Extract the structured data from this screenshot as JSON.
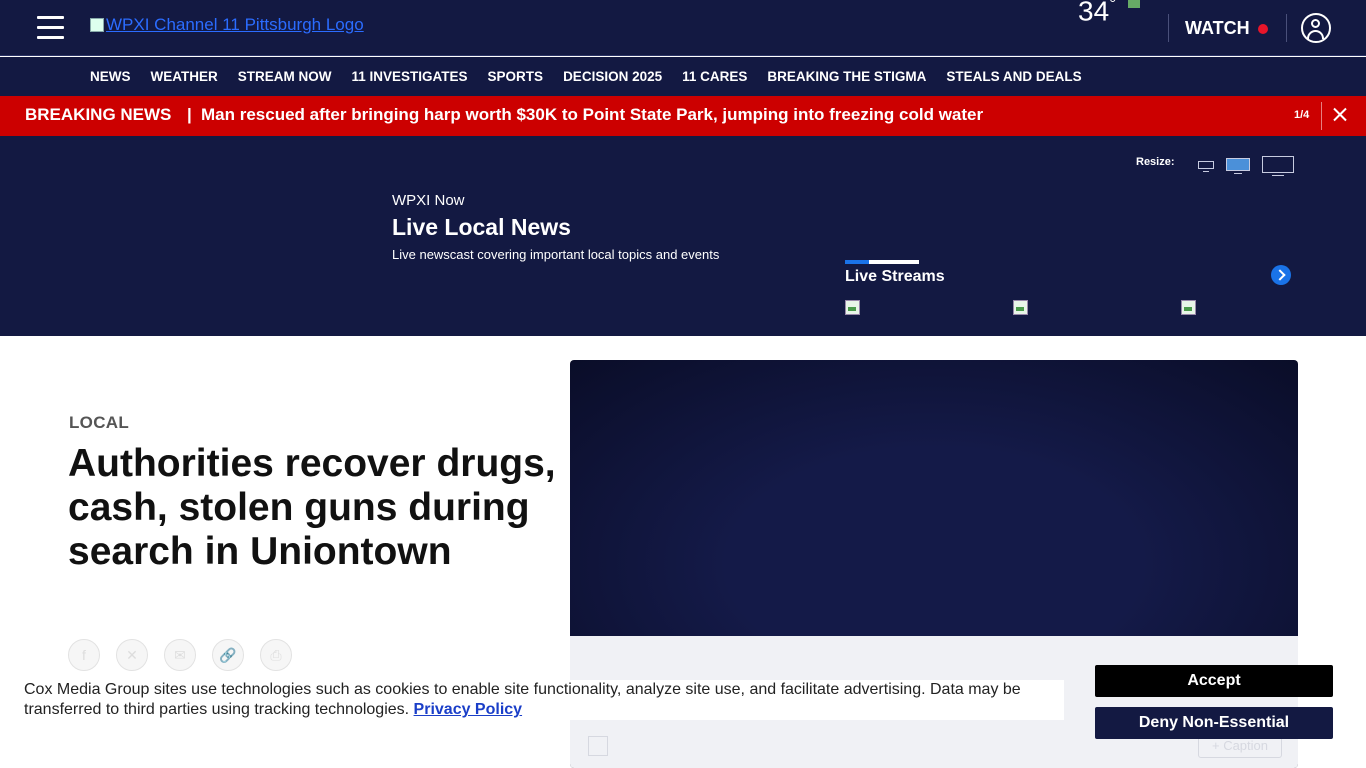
{
  "header": {
    "logo_alt": "WPXI Channel 11 Pittsburgh Logo",
    "temperature": "34",
    "degree": "°",
    "watch_label": "WATCH"
  },
  "nav": {
    "items": [
      "NEWS",
      "WEATHER",
      "STREAM NOW",
      "11 INVESTIGATES",
      "SPORTS",
      "DECISION 2025",
      "11 CARES",
      "BREAKING THE STIGMA",
      "STEALS AND DEALS"
    ]
  },
  "breaking": {
    "label": "BREAKING NEWS",
    "separator": "|",
    "headline": "Man rescued after bringing harp worth $30K to Point State Park, jumping into freezing cold water",
    "counter": "1/4"
  },
  "live": {
    "resize_label": "Resize:",
    "kicker": "WPXI Now",
    "title": "Live Local News",
    "description": "Live newscast covering important local topics and events",
    "streams_title": "Live Streams"
  },
  "article": {
    "kicker": "LOCAL",
    "headline": "Authorities recover drugs, cash, stolen guns during search in Uniontown",
    "caption_button": "+ Caption"
  },
  "cookie": {
    "text": "Cox Media Group sites use technologies such as cookies to enable site functionality, analyze site use, and facilitate advertising. Data may be transferred to third parties using tracking technologies.",
    "link": "Privacy Policy",
    "accept": "Accept",
    "deny": "Deny Non-Essential"
  },
  "colors": {
    "navy": "#131942",
    "breaking_red": "#cc0000",
    "accent_blue": "#1a73e8"
  }
}
